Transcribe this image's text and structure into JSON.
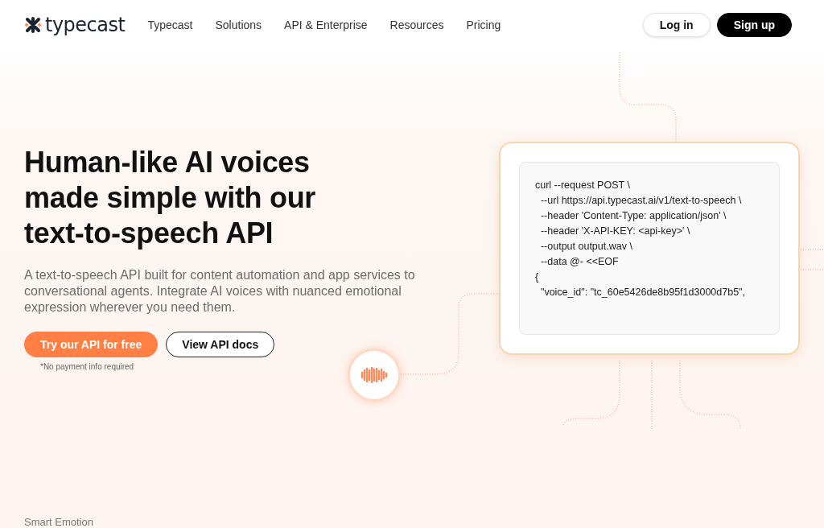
{
  "nav": {
    "logo": "typecast",
    "links": [
      "Typecast",
      "Solutions",
      "API & Enterprise",
      "Resources",
      "Pricing"
    ],
    "login": "Log in",
    "signup": "Sign up"
  },
  "hero": {
    "title": "Human-like AI voices made simple with our text-to-speech API",
    "subtitle": "A text-to-speech API built for content automation and app services to conversational agents. Integrate AI voices with nuanced emotional expression wherever you need them.",
    "primary_button": "Try our API for free",
    "secondary_button": "View API docs",
    "note": "*No payment info required"
  },
  "code": [
    "curl --request POST \\",
    "  --url https://api.typecast.ai/v1/text-to-speech \\",
    "  --header 'Content-Type: application/json' \\",
    "  --header 'X-API-KEY: <api-key>' \\",
    "  --output output.wav \\",
    "  --data @- <<EOF",
    "{",
    "  \"voice_id\": \"tc_60e5426de8b95f1d3000d7b5\","
  ],
  "next_section": "Smart Emotion"
}
